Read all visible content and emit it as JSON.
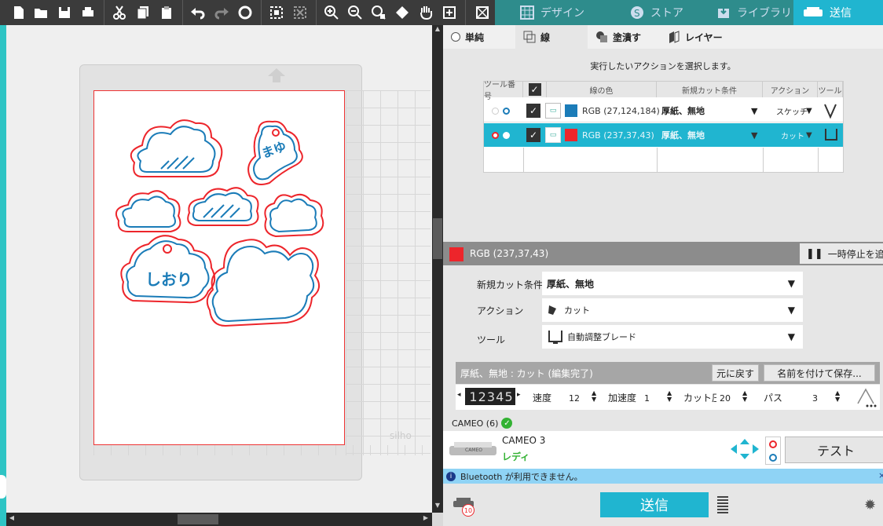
{
  "toolbar": {
    "icons": [
      "new-document-icon",
      "open-folder-icon",
      "save-icon",
      "print-icon",
      "cut-icon",
      "copy-icon",
      "paste-icon",
      "undo-icon",
      "redo-icon",
      "refresh-icon",
      "group-icon",
      "ungroup-icon",
      "zoom-in-icon",
      "zoom-out-icon",
      "zoom-select-icon",
      "move-down-icon",
      "pan-hand-icon",
      "fit-icon",
      "silhouette-logo-icon"
    ]
  },
  "nav": {
    "design": "デザイン",
    "store": "ストア",
    "library": "ライブラリ",
    "send": "送信"
  },
  "canvas": {
    "watermark": "silho",
    "shape_text_1": "まゆ",
    "shape_text_2": "しおり"
  },
  "panel": {
    "tabs": [
      "単純",
      "線",
      "塗潰す",
      "レイヤー"
    ],
    "instruction": "実行したいアクションを選択します。",
    "table": {
      "headers": [
        "ツール番号",
        "",
        "線の色",
        "新規カット条件",
        "アクション",
        "ツール"
      ],
      "rows": [
        {
          "color_label": "RGB (27,124,184)",
          "color": "#1b7cb8",
          "condition": "厚紙、無地",
          "action": "スケッチ"
        },
        {
          "color_label": "RGB (237,37,43)",
          "color": "#ed252b",
          "condition": "厚紙、無地",
          "action": "カット"
        }
      ]
    },
    "selected_color_label": "RGB (237,37,43)",
    "selected_color": "#ed252b",
    "pause_label": "一時停止を追",
    "settings": {
      "condition_label": "新規カット条件",
      "condition_value": "厚紙、無地",
      "action_label": "アクション",
      "action_value": "カット",
      "tool_label": "ツール",
      "tool_value": "自動調整ブレード"
    },
    "preset": {
      "title": "厚紙、無地 : カット (編集完了)",
      "revert": "元に戻す",
      "save_as": "名前を付けて保存..."
    },
    "params": {
      "blade_digits": "1 2 3 4 5",
      "speed_label": "速度",
      "speed": "12",
      "accel_label": "加速度",
      "accel": "1",
      "force_label": "カット圧",
      "force": "20",
      "passes_label": "パス",
      "passes": "3"
    },
    "device": {
      "header": "CAMEO (6)",
      "name": "CAMEO 3",
      "status": "レディ",
      "device_label": "CAMEO",
      "test": "テスト"
    },
    "bluetooth": "Bluetooth が利用できません。",
    "send_button": "送信",
    "queue_count": "10"
  },
  "colors": {
    "cyan": "#20b5d0",
    "red": "#ed252b",
    "blue": "#1b7cb8",
    "ready_green": "#33b233"
  }
}
